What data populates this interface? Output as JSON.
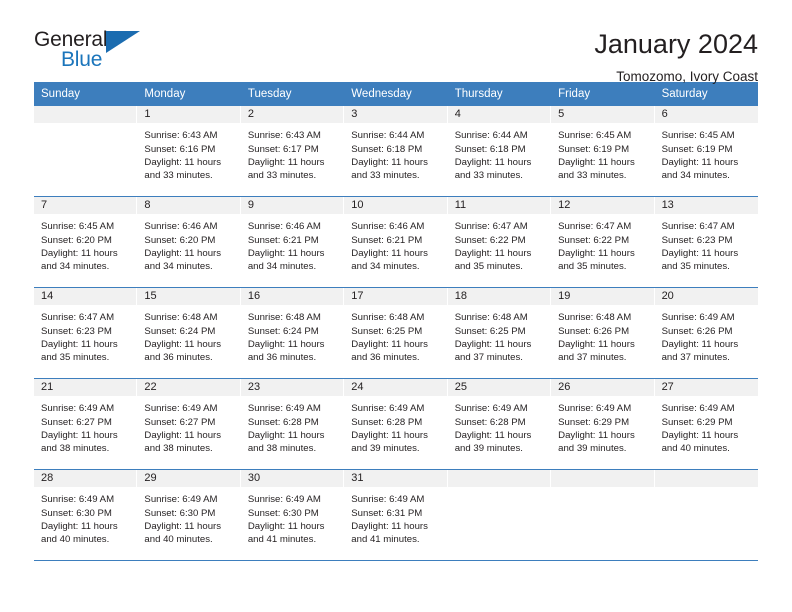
{
  "brand": {
    "word_one": "General",
    "word_two": "Blue",
    "triangle_icon": "triangle-icon"
  },
  "header": {
    "title": "January 2024",
    "subtitle": "Tomozomo, Ivory Coast"
  },
  "colors": {
    "header_blue": "#3d7ebd",
    "brand_blue": "#1b75bb",
    "day_band_gray": "#f1f1f1",
    "text": "#231f20"
  },
  "weekdays": [
    "Sunday",
    "Monday",
    "Tuesday",
    "Wednesday",
    "Thursday",
    "Friday",
    "Saturday"
  ],
  "labels": {
    "sunrise_prefix": "Sunrise:",
    "sunset_prefix": "Sunset:",
    "daylight_prefix": "Daylight:"
  },
  "weeks": [
    [
      {
        "day": "",
        "empty": true,
        "sunrise": "",
        "sunset": "",
        "daylight_line1": "",
        "daylight_line2": ""
      },
      {
        "day": "1",
        "sunrise": "Sunrise: 6:43 AM",
        "sunset": "Sunset: 6:16 PM",
        "daylight_line1": "Daylight: 11 hours",
        "daylight_line2": "and 33 minutes."
      },
      {
        "day": "2",
        "sunrise": "Sunrise: 6:43 AM",
        "sunset": "Sunset: 6:17 PM",
        "daylight_line1": "Daylight: 11 hours",
        "daylight_line2": "and 33 minutes."
      },
      {
        "day": "3",
        "sunrise": "Sunrise: 6:44 AM",
        "sunset": "Sunset: 6:18 PM",
        "daylight_line1": "Daylight: 11 hours",
        "daylight_line2": "and 33 minutes."
      },
      {
        "day": "4",
        "sunrise": "Sunrise: 6:44 AM",
        "sunset": "Sunset: 6:18 PM",
        "daylight_line1": "Daylight: 11 hours",
        "daylight_line2": "and 33 minutes."
      },
      {
        "day": "5",
        "sunrise": "Sunrise: 6:45 AM",
        "sunset": "Sunset: 6:19 PM",
        "daylight_line1": "Daylight: 11 hours",
        "daylight_line2": "and 33 minutes."
      },
      {
        "day": "6",
        "sunrise": "Sunrise: 6:45 AM",
        "sunset": "Sunset: 6:19 PM",
        "daylight_line1": "Daylight: 11 hours",
        "daylight_line2": "and 34 minutes."
      }
    ],
    [
      {
        "day": "7",
        "sunrise": "Sunrise: 6:45 AM",
        "sunset": "Sunset: 6:20 PM",
        "daylight_line1": "Daylight: 11 hours",
        "daylight_line2": "and 34 minutes."
      },
      {
        "day": "8",
        "sunrise": "Sunrise: 6:46 AM",
        "sunset": "Sunset: 6:20 PM",
        "daylight_line1": "Daylight: 11 hours",
        "daylight_line2": "and 34 minutes."
      },
      {
        "day": "9",
        "sunrise": "Sunrise: 6:46 AM",
        "sunset": "Sunset: 6:21 PM",
        "daylight_line1": "Daylight: 11 hours",
        "daylight_line2": "and 34 minutes."
      },
      {
        "day": "10",
        "sunrise": "Sunrise: 6:46 AM",
        "sunset": "Sunset: 6:21 PM",
        "daylight_line1": "Daylight: 11 hours",
        "daylight_line2": "and 34 minutes."
      },
      {
        "day": "11",
        "sunrise": "Sunrise: 6:47 AM",
        "sunset": "Sunset: 6:22 PM",
        "daylight_line1": "Daylight: 11 hours",
        "daylight_line2": "and 35 minutes."
      },
      {
        "day": "12",
        "sunrise": "Sunrise: 6:47 AM",
        "sunset": "Sunset: 6:22 PM",
        "daylight_line1": "Daylight: 11 hours",
        "daylight_line2": "and 35 minutes."
      },
      {
        "day": "13",
        "sunrise": "Sunrise: 6:47 AM",
        "sunset": "Sunset: 6:23 PM",
        "daylight_line1": "Daylight: 11 hours",
        "daylight_line2": "and 35 minutes."
      }
    ],
    [
      {
        "day": "14",
        "sunrise": "Sunrise: 6:47 AM",
        "sunset": "Sunset: 6:23 PM",
        "daylight_line1": "Daylight: 11 hours",
        "daylight_line2": "and 35 minutes."
      },
      {
        "day": "15",
        "sunrise": "Sunrise: 6:48 AM",
        "sunset": "Sunset: 6:24 PM",
        "daylight_line1": "Daylight: 11 hours",
        "daylight_line2": "and 36 minutes."
      },
      {
        "day": "16",
        "sunrise": "Sunrise: 6:48 AM",
        "sunset": "Sunset: 6:24 PM",
        "daylight_line1": "Daylight: 11 hours",
        "daylight_line2": "and 36 minutes."
      },
      {
        "day": "17",
        "sunrise": "Sunrise: 6:48 AM",
        "sunset": "Sunset: 6:25 PM",
        "daylight_line1": "Daylight: 11 hours",
        "daylight_line2": "and 36 minutes."
      },
      {
        "day": "18",
        "sunrise": "Sunrise: 6:48 AM",
        "sunset": "Sunset: 6:25 PM",
        "daylight_line1": "Daylight: 11 hours",
        "daylight_line2": "and 37 minutes."
      },
      {
        "day": "19",
        "sunrise": "Sunrise: 6:48 AM",
        "sunset": "Sunset: 6:26 PM",
        "daylight_line1": "Daylight: 11 hours",
        "daylight_line2": "and 37 minutes."
      },
      {
        "day": "20",
        "sunrise": "Sunrise: 6:49 AM",
        "sunset": "Sunset: 6:26 PM",
        "daylight_line1": "Daylight: 11 hours",
        "daylight_line2": "and 37 minutes."
      }
    ],
    [
      {
        "day": "21",
        "sunrise": "Sunrise: 6:49 AM",
        "sunset": "Sunset: 6:27 PM",
        "daylight_line1": "Daylight: 11 hours",
        "daylight_line2": "and 38 minutes."
      },
      {
        "day": "22",
        "sunrise": "Sunrise: 6:49 AM",
        "sunset": "Sunset: 6:27 PM",
        "daylight_line1": "Daylight: 11 hours",
        "daylight_line2": "and 38 minutes."
      },
      {
        "day": "23",
        "sunrise": "Sunrise: 6:49 AM",
        "sunset": "Sunset: 6:28 PM",
        "daylight_line1": "Daylight: 11 hours",
        "daylight_line2": "and 38 minutes."
      },
      {
        "day": "24",
        "sunrise": "Sunrise: 6:49 AM",
        "sunset": "Sunset: 6:28 PM",
        "daylight_line1": "Daylight: 11 hours",
        "daylight_line2": "and 39 minutes."
      },
      {
        "day": "25",
        "sunrise": "Sunrise: 6:49 AM",
        "sunset": "Sunset: 6:28 PM",
        "daylight_line1": "Daylight: 11 hours",
        "daylight_line2": "and 39 minutes."
      },
      {
        "day": "26",
        "sunrise": "Sunrise: 6:49 AM",
        "sunset": "Sunset: 6:29 PM",
        "daylight_line1": "Daylight: 11 hours",
        "daylight_line2": "and 39 minutes."
      },
      {
        "day": "27",
        "sunrise": "Sunrise: 6:49 AM",
        "sunset": "Sunset: 6:29 PM",
        "daylight_line1": "Daylight: 11 hours",
        "daylight_line2": "and 40 minutes."
      }
    ],
    [
      {
        "day": "28",
        "sunrise": "Sunrise: 6:49 AM",
        "sunset": "Sunset: 6:30 PM",
        "daylight_line1": "Daylight: 11 hours",
        "daylight_line2": "and 40 minutes."
      },
      {
        "day": "29",
        "sunrise": "Sunrise: 6:49 AM",
        "sunset": "Sunset: 6:30 PM",
        "daylight_line1": "Daylight: 11 hours",
        "daylight_line2": "and 40 minutes."
      },
      {
        "day": "30",
        "sunrise": "Sunrise: 6:49 AM",
        "sunset": "Sunset: 6:30 PM",
        "daylight_line1": "Daylight: 11 hours",
        "daylight_line2": "and 41 minutes."
      },
      {
        "day": "31",
        "sunrise": "Sunrise: 6:49 AM",
        "sunset": "Sunset: 6:31 PM",
        "daylight_line1": "Daylight: 11 hours",
        "daylight_line2": "and 41 minutes."
      },
      {
        "day": "",
        "empty": true,
        "sunrise": "",
        "sunset": "",
        "daylight_line1": "",
        "daylight_line2": ""
      },
      {
        "day": "",
        "empty": true,
        "sunrise": "",
        "sunset": "",
        "daylight_line1": "",
        "daylight_line2": ""
      },
      {
        "day": "",
        "empty": true,
        "sunrise": "",
        "sunset": "",
        "daylight_line1": "",
        "daylight_line2": ""
      }
    ]
  ]
}
